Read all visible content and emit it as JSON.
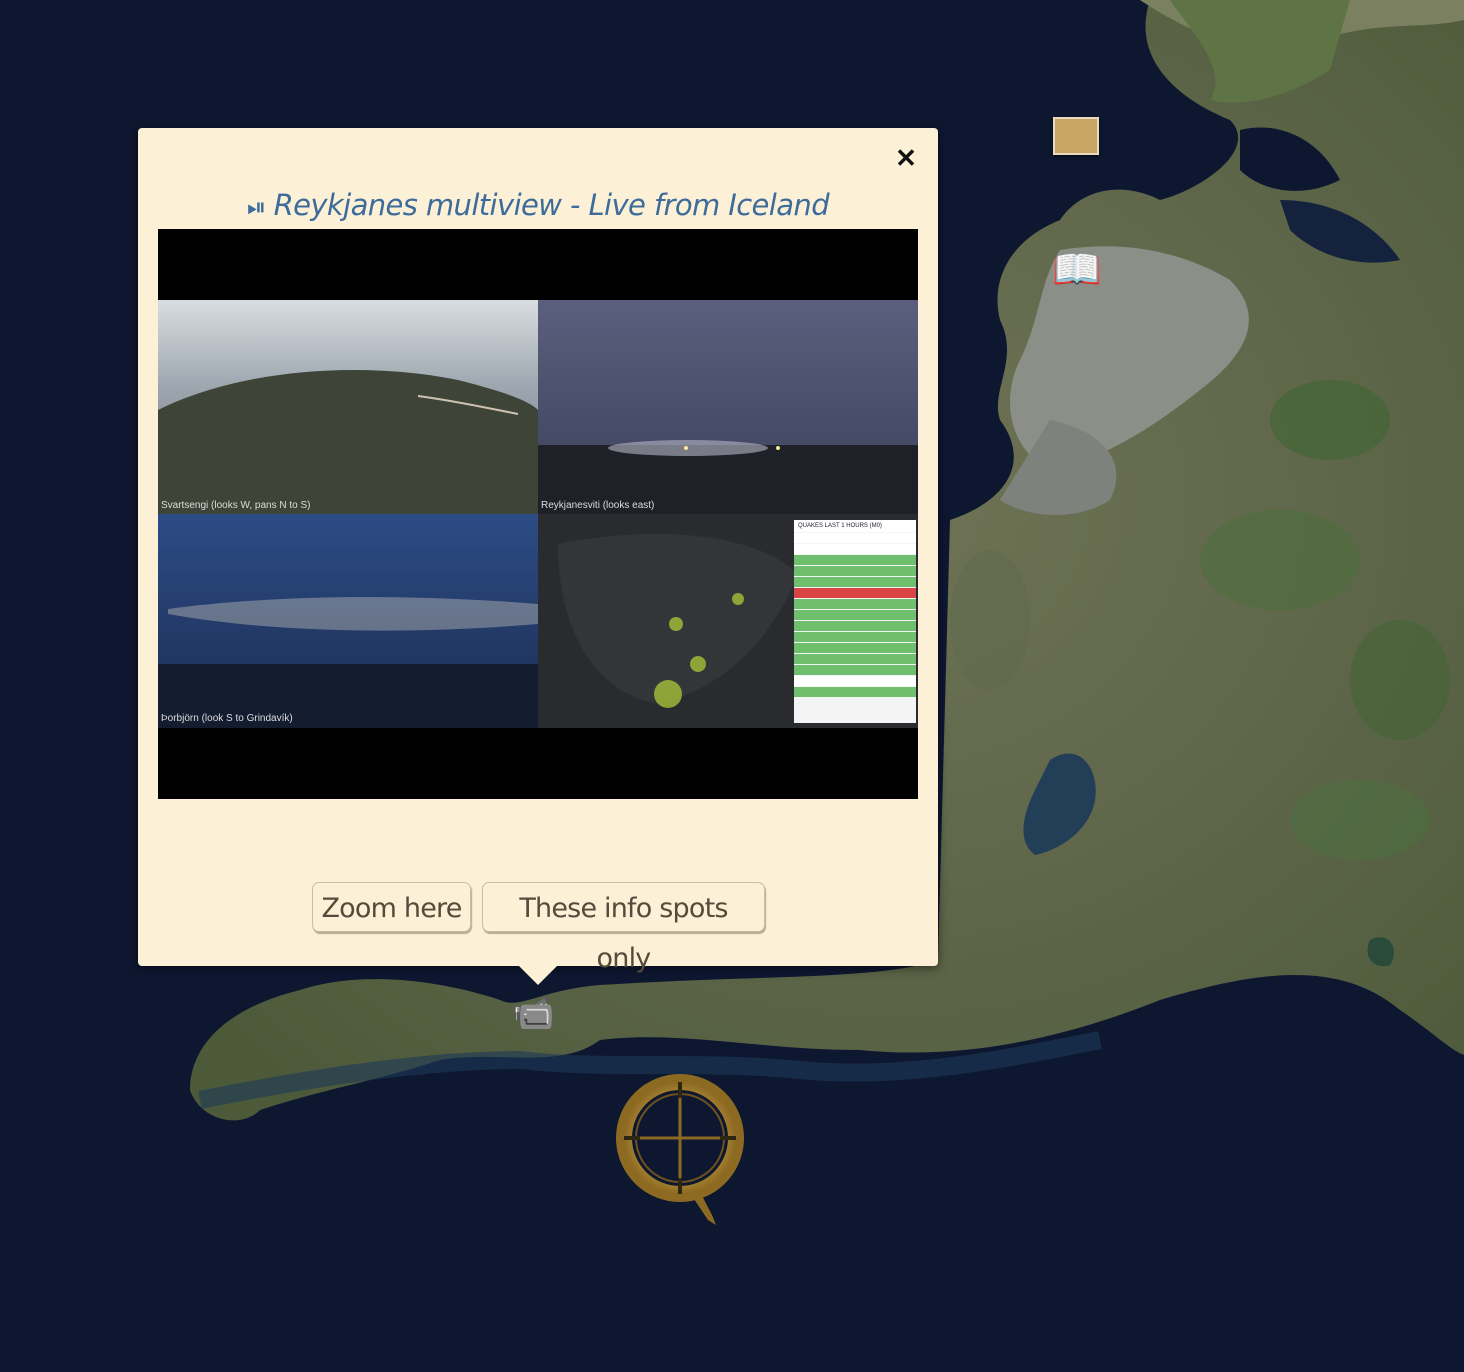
{
  "map": {
    "markers": [
      {
        "name": "book-marker-icon",
        "glyph": "📖"
      },
      {
        "name": "video-camera-marker-icon",
        "glyph": "📹"
      },
      {
        "name": "map-tile-marker-icon"
      },
      {
        "name": "compass-ring-icon"
      }
    ]
  },
  "popup": {
    "play_icon": "⏯",
    "title": "Reykjanes multiview - Live from Iceland",
    "close_glyph": "✕",
    "video": {
      "panels": [
        {
          "label": "Svartsengi (looks W, pans N to S)"
        },
        {
          "label": "Reykjanesviti (looks east)"
        },
        {
          "label": "Þorbjörn (look S to Grindavík)"
        }
      ],
      "table_header": "QUAKES LAST 1 HOURS (M0)"
    },
    "buttons": {
      "zoom": "Zoom here",
      "spots": "These info spots only"
    }
  },
  "colors": {
    "popup_bg": "#fcf1d6",
    "title": "#3e6c9a",
    "ocean": "#0e1730"
  }
}
